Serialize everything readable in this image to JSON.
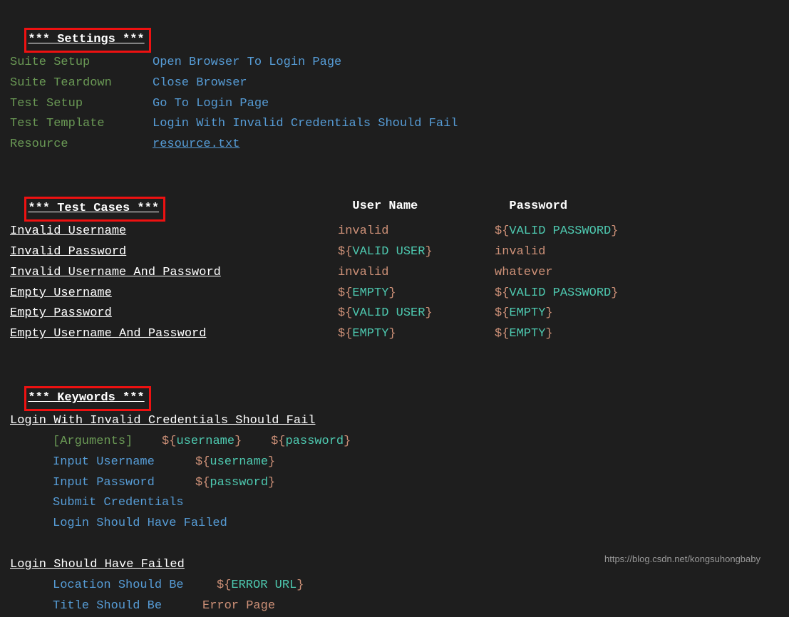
{
  "sections": {
    "settings_header": "*** Settings ***",
    "testcases_header": "*** Test Cases ***",
    "keywords_header": "*** Keywords ***"
  },
  "settings": {
    "suite_setup_key": "Suite Setup",
    "suite_setup_val": "Open Browser To Login Page",
    "suite_teardown_key": "Suite Teardown",
    "suite_teardown_val": "Close Browser",
    "test_setup_key": "Test Setup",
    "test_setup_val": "Go To Login Page",
    "test_template_key": "Test Template",
    "test_template_val": "Login With Invalid Credentials Should Fail",
    "resource_key": "Resource",
    "resource_val": "resource.txt"
  },
  "tc_columns": {
    "c1": "User Name",
    "c2": "Password"
  },
  "tc": [
    {
      "name": "Invalid Username",
      "user_pre": "",
      "user_var": "",
      "user_post": "invalid",
      "pw_pre": "${",
      "pw_var": "VALID PASSWORD",
      "pw_post": "}"
    },
    {
      "name": "Invalid Password",
      "user_pre": "${",
      "user_var": "VALID USER",
      "user_post": "}",
      "pw_pre": "",
      "pw_var": "",
      "pw_post": "invalid"
    },
    {
      "name": "Invalid Username And Password",
      "user_pre": "",
      "user_var": "",
      "user_post": "invalid",
      "pw_pre": "",
      "pw_var": "",
      "pw_post": "whatever"
    },
    {
      "name": "Empty Username",
      "user_pre": "${",
      "user_var": "EMPTY",
      "user_post": "}",
      "pw_pre": "${",
      "pw_var": "VALID PASSWORD",
      "pw_post": "}"
    },
    {
      "name": "Empty Password",
      "user_pre": "${",
      "user_var": "VALID USER",
      "user_post": "}",
      "pw_pre": "${",
      "pw_var": "EMPTY",
      "pw_post": "}"
    },
    {
      "name": "Empty Username And Password",
      "user_pre": "${",
      "user_var": "EMPTY",
      "user_post": "}",
      "pw_pre": "${",
      "pw_var": "EMPTY",
      "pw_post": "}"
    }
  ],
  "kw1": {
    "name": "Login With Invalid Credentials Should Fail",
    "args_label": "[Arguments]",
    "arg1_pre": "${",
    "arg1_var": "username",
    "arg1_post": "}",
    "arg2_pre": "${",
    "arg2_var": "password",
    "arg2_post": "}",
    "step1": "Input Username",
    "step1_arg_pre": "${",
    "step1_arg_var": "username",
    "step1_arg_post": "}",
    "step2": "Input Password",
    "step2_arg_pre": "${",
    "step2_arg_var": "password",
    "step2_arg_post": "}",
    "step3": "Submit Credentials",
    "step4": "Login Should Have Failed"
  },
  "kw2": {
    "name": "Login Should Have Failed",
    "step1": "Location Should Be",
    "step1_arg_pre": "${",
    "step1_arg_var": "ERROR URL",
    "step1_arg_post": "}",
    "step2": "Title Should Be",
    "step2_arg": "Error Page"
  },
  "watermark": "https://blog.csdn.net/kongsuhongbaby"
}
